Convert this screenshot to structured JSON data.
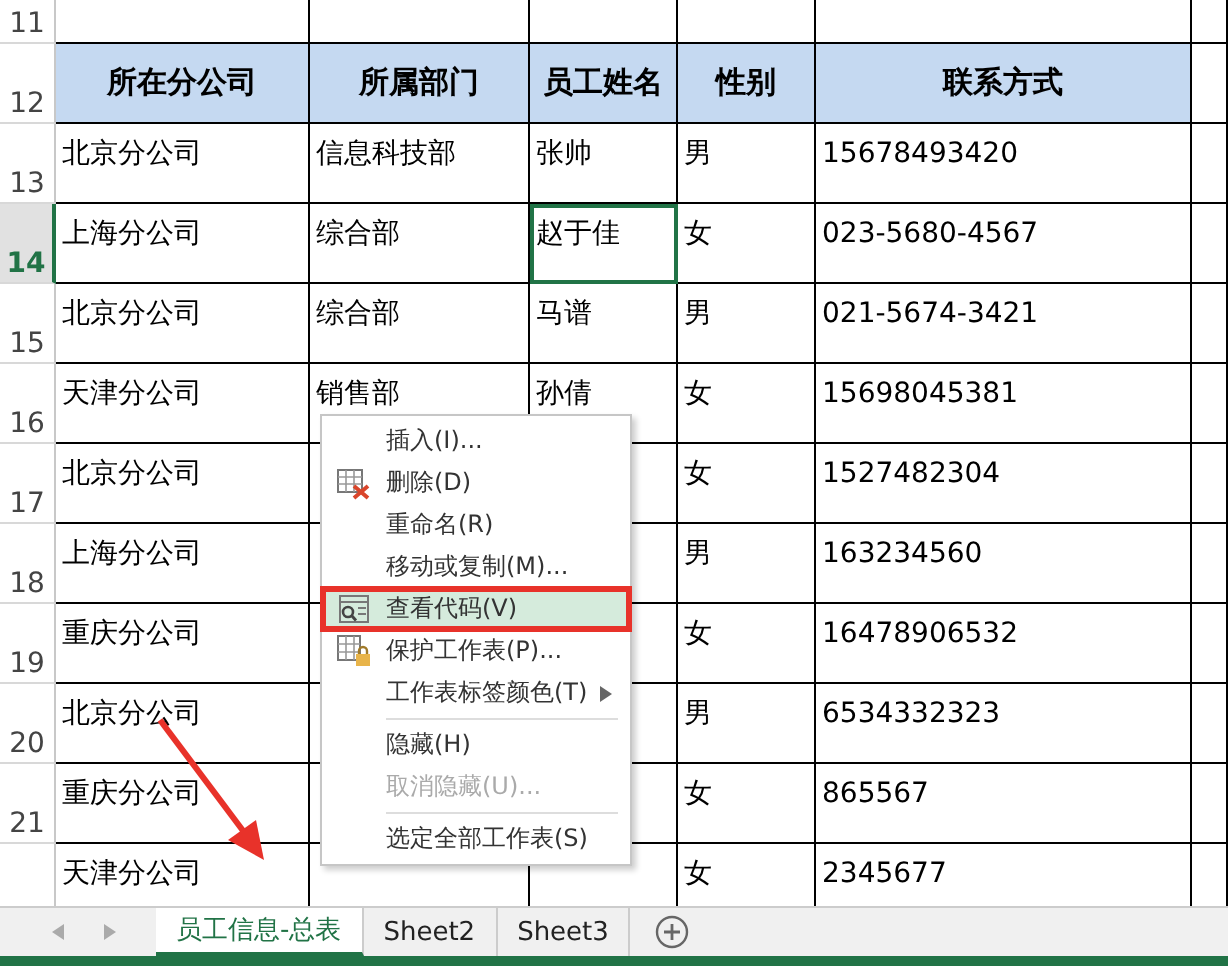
{
  "sheet": {
    "rows": [
      {
        "number": "11",
        "kind": "blank",
        "selected": false,
        "cells": [
          null,
          null,
          null,
          null,
          null
        ]
      },
      {
        "number": "12",
        "kind": "header",
        "selected": false,
        "cells": [
          {
            "text": "所在分公司",
            "selected": false
          },
          {
            "text": "所属部门",
            "selected": false
          },
          {
            "text": "员工姓名",
            "selected": false
          },
          {
            "text": "性别",
            "selected": false
          },
          {
            "text": "联系方式",
            "selected": false
          }
        ]
      },
      {
        "number": "13",
        "kind": "data",
        "selected": false,
        "cells": [
          {
            "text": "北京分公司",
            "selected": false
          },
          {
            "text": "信息科技部",
            "selected": false
          },
          {
            "text": "张帅",
            "selected": false
          },
          {
            "text": "男",
            "selected": false
          },
          {
            "text": "15678493420",
            "selected": false
          }
        ]
      },
      {
        "number": "14",
        "kind": "data",
        "selected": true,
        "cells": [
          {
            "text": "上海分公司",
            "selected": false
          },
          {
            "text": "综合部",
            "selected": false
          },
          {
            "text": "赵于佳",
            "selected": true
          },
          {
            "text": "女",
            "selected": false
          },
          {
            "text": "023-5680-4567",
            "selected": false
          }
        ]
      },
      {
        "number": "15",
        "kind": "data",
        "selected": false,
        "cells": [
          {
            "text": "北京分公司",
            "selected": false
          },
          {
            "text": "综合部",
            "selected": false
          },
          {
            "text": "马谱",
            "selected": false
          },
          {
            "text": "男",
            "selected": false
          },
          {
            "text": "021-5674-3421",
            "selected": false
          }
        ]
      },
      {
        "number": "16",
        "kind": "data",
        "selected": false,
        "cells": [
          {
            "text": "天津分公司",
            "selected": false
          },
          {
            "text": "销售部",
            "selected": false
          },
          {
            "text": "孙倩",
            "selected": false
          },
          {
            "text": "女",
            "selected": false
          },
          {
            "text": "15698045381",
            "selected": false
          }
        ]
      },
      {
        "number": "17",
        "kind": "data",
        "selected": false,
        "cells": [
          {
            "text": "北京分公司",
            "selected": false
          },
          null,
          null,
          {
            "text": "女",
            "selected": false
          },
          {
            "text": "1527482304",
            "selected": false
          }
        ]
      },
      {
        "number": "18",
        "kind": "data",
        "selected": false,
        "cells": [
          {
            "text": "上海分公司",
            "selected": false
          },
          null,
          null,
          {
            "text": "男",
            "selected": false
          },
          {
            "text": "163234560",
            "selected": false
          }
        ]
      },
      {
        "number": "19",
        "kind": "data",
        "selected": false,
        "cells": [
          {
            "text": "重庆分公司",
            "selected": false
          },
          null,
          null,
          {
            "text": "女",
            "selected": false
          },
          {
            "text": "16478906532",
            "selected": false
          }
        ]
      },
      {
        "number": "20",
        "kind": "data",
        "selected": false,
        "cells": [
          {
            "text": "北京分公司",
            "selected": false
          },
          null,
          null,
          {
            "text": "男",
            "selected": false
          },
          {
            "text": "6534332323",
            "selected": false
          }
        ]
      },
      {
        "number": "21",
        "kind": "data",
        "selected": false,
        "cells": [
          {
            "text": "重庆分公司",
            "selected": false
          },
          null,
          null,
          {
            "text": "女",
            "selected": false
          },
          {
            "text": "865567",
            "selected": false
          }
        ]
      },
      {
        "kind": "data",
        "selected": false,
        "cells": [
          {
            "text": "天津分公司",
            "selected": false
          },
          null,
          null,
          {
            "text": "女",
            "selected": false
          },
          {
            "text": "2345677",
            "selected": false
          }
        ]
      }
    ]
  },
  "context_menu": {
    "items": [
      {
        "kind": "plain",
        "label": "插入(I)...",
        "disabled": false,
        "submenu": false,
        "selected": false,
        "outlined": false
      },
      {
        "kind": "delete",
        "label": "删除(D)",
        "disabled": false,
        "submenu": false,
        "selected": false,
        "outlined": false
      },
      {
        "kind": "plain",
        "label": "重命名(R)",
        "disabled": false,
        "submenu": false,
        "selected": false,
        "outlined": false
      },
      {
        "kind": "plain",
        "label": "移动或复制(M)...",
        "disabled": false,
        "submenu": false,
        "selected": false,
        "outlined": false
      },
      {
        "kind": "code",
        "label": "查看代码(V)",
        "disabled": false,
        "submenu": false,
        "selected": true,
        "outlined": true
      },
      {
        "kind": "protect",
        "label": "保护工作表(P)...",
        "disabled": false,
        "submenu": false,
        "selected": false,
        "outlined": false
      },
      {
        "kind": "plain",
        "label": "工作表标签颜色(T)",
        "disabled": false,
        "submenu": true,
        "selected": false,
        "outlined": false
      },
      {
        "kind": "separator"
      },
      {
        "kind": "plain",
        "label": "隐藏(H)",
        "disabled": false,
        "submenu": false,
        "selected": false,
        "outlined": false
      },
      {
        "kind": "plain",
        "label": "取消隐藏(U)...",
        "disabled": true,
        "submenu": false,
        "selected": false,
        "outlined": false
      },
      {
        "kind": "separator"
      },
      {
        "kind": "plain",
        "label": "选定全部工作表(S)",
        "disabled": false,
        "submenu": false,
        "selected": false,
        "outlined": false
      }
    ]
  },
  "sheet_tabs": [
    {
      "label": "员工信息-总表",
      "selected": true
    },
    {
      "label": "Sheet2",
      "selected": false
    },
    {
      "label": "Sheet3",
      "selected": false
    }
  ],
  "callout_arrow": true
}
